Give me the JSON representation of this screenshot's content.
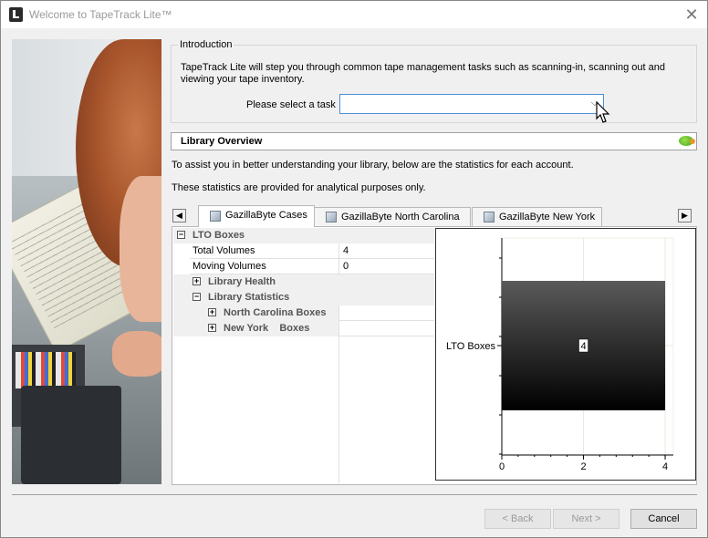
{
  "window": {
    "title": "Welcome to TapeTrack Lite™",
    "close_glyph": "✕"
  },
  "intro": {
    "group_title": "Introduction",
    "description": "TapeTrack Lite will step you through common tape management tasks such as scanning-in, scanning out and viewing your tape inventory.",
    "task_label": "Please select a task",
    "task_value": "",
    "task_chevron": "⌵"
  },
  "library_overview": {
    "title": "Library Overview",
    "assist_text": "To assist you in better understanding your library, below are the statistics for each account.",
    "stats_text": "These statistics are provided for analytical purposes only."
  },
  "tabs": {
    "scroll_left": "◀",
    "scroll_right": "▶",
    "items": [
      {
        "label": "GazillaByte Cases",
        "active": true
      },
      {
        "label": "GazillaByte North Carolina",
        "active": false
      },
      {
        "label": "GazillaByte New York",
        "active": false
      }
    ]
  },
  "grid": {
    "rows": [
      {
        "label": "LTO Boxes",
        "toggle": "⊟",
        "value": ""
      },
      {
        "label": "Total Volumes",
        "toggle": "",
        "value": "4"
      },
      {
        "label": "Moving Volumes",
        "toggle": "",
        "value": "0"
      },
      {
        "label": "Library Health",
        "toggle": "+",
        "value": ""
      },
      {
        "label": "Library Statistics",
        "toggle": "−",
        "value": ""
      },
      {
        "label": "North Carolina Boxes",
        "toggle": "+",
        "value": ""
      },
      {
        "label": "New York    Boxes",
        "toggle": "+",
        "value": ""
      }
    ]
  },
  "chart_data": {
    "type": "bar",
    "orientation": "horizontal",
    "categories": [
      "LTO Boxes"
    ],
    "values": [
      4
    ],
    "data_labels": [
      "4"
    ],
    "xlim": [
      0,
      4.2
    ],
    "x_ticks": [
      "0",
      "2",
      "4"
    ],
    "grid": true,
    "bar_fill": "gradient #505050 to #000000",
    "title": "",
    "xlabel": "",
    "ylabel": ""
  },
  "buttons": {
    "back": "< Back",
    "next": "Next >",
    "cancel": "Cancel"
  },
  "colors": {
    "focus_border": "#4a90d9",
    "disabled_text": "#9a9a9a",
    "window_bg": "#f0f0f0"
  }
}
